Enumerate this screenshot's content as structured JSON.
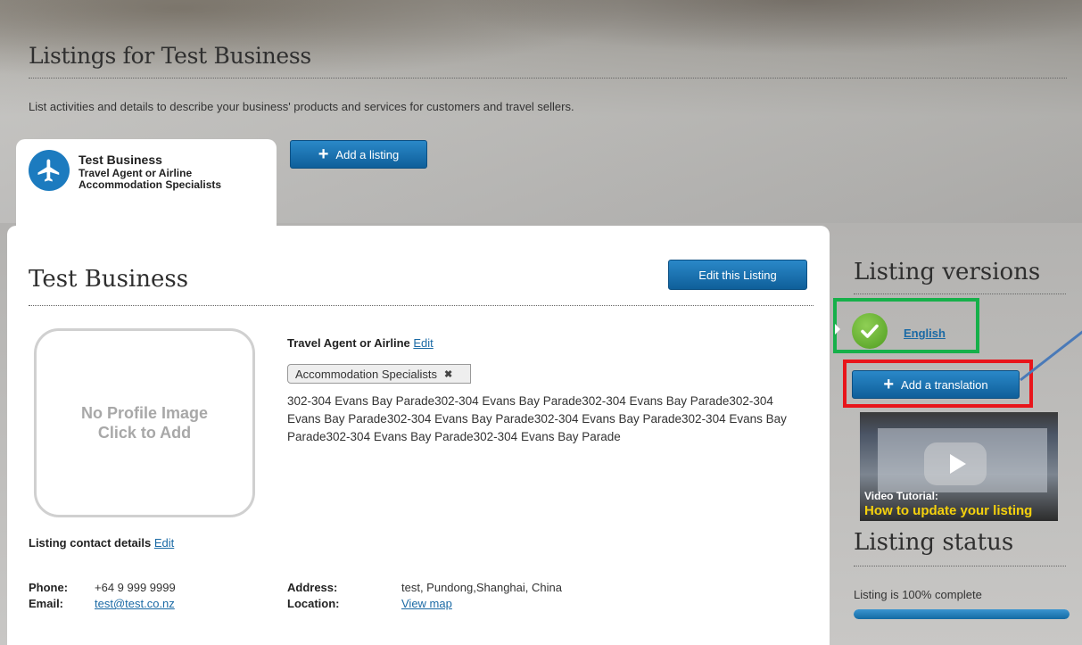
{
  "header": {
    "title": "Listings for Test Business",
    "intro": "List activities and details to describe your business' products and services for customers and travel sellers."
  },
  "business_tab": {
    "name": "Test Business",
    "line1": "Travel Agent or Airline",
    "line2": "Accommodation Specialists",
    "icon": "airplane-icon"
  },
  "toolbar": {
    "add_listing_label": "Add a listing"
  },
  "listing": {
    "title": "Test Business",
    "edit_listing_label": "Edit this Listing",
    "profile_image_line1": "No Profile Image",
    "profile_image_line2": "Click to Add",
    "category": "Travel Agent or Airline",
    "category_edit": "Edit",
    "tag": "Accommodation Specialists",
    "address_text": "302-304 Evans Bay Parade302-304 Evans Bay Parade302-304 Evans Bay Parade302-304 Evans Bay Parade302-304 Evans Bay Parade302-304 Evans Bay Parade302-304 Evans Bay Parade302-304 Evans Bay Parade302-304 Evans Bay Parade",
    "contact_heading": "Listing contact details",
    "contact_edit": "Edit",
    "phone_label": "Phone:",
    "phone_value": "+64 9 999 9999",
    "email_label": "Email:",
    "email_value": "test@test.co.nz",
    "address_label": "Address:",
    "address_value": "test, Pundong,Shanghai, China",
    "location_label": "Location:",
    "location_value": "View map"
  },
  "sidebar": {
    "versions_title": "Listing versions",
    "version_english": "English",
    "add_translation_label": "Add a translation",
    "video_line1": "Video Tutorial:",
    "video_line2": "How to update your listing",
    "status_title": "Listing status",
    "status_text": "Listing is 100% complete",
    "completion_percent": 100
  },
  "colors": {
    "accent_blue": "#1c7bbf",
    "highlight_green": "#16b04a",
    "highlight_red": "#e8151b",
    "annotation_arrow": "#4a7ab8"
  }
}
